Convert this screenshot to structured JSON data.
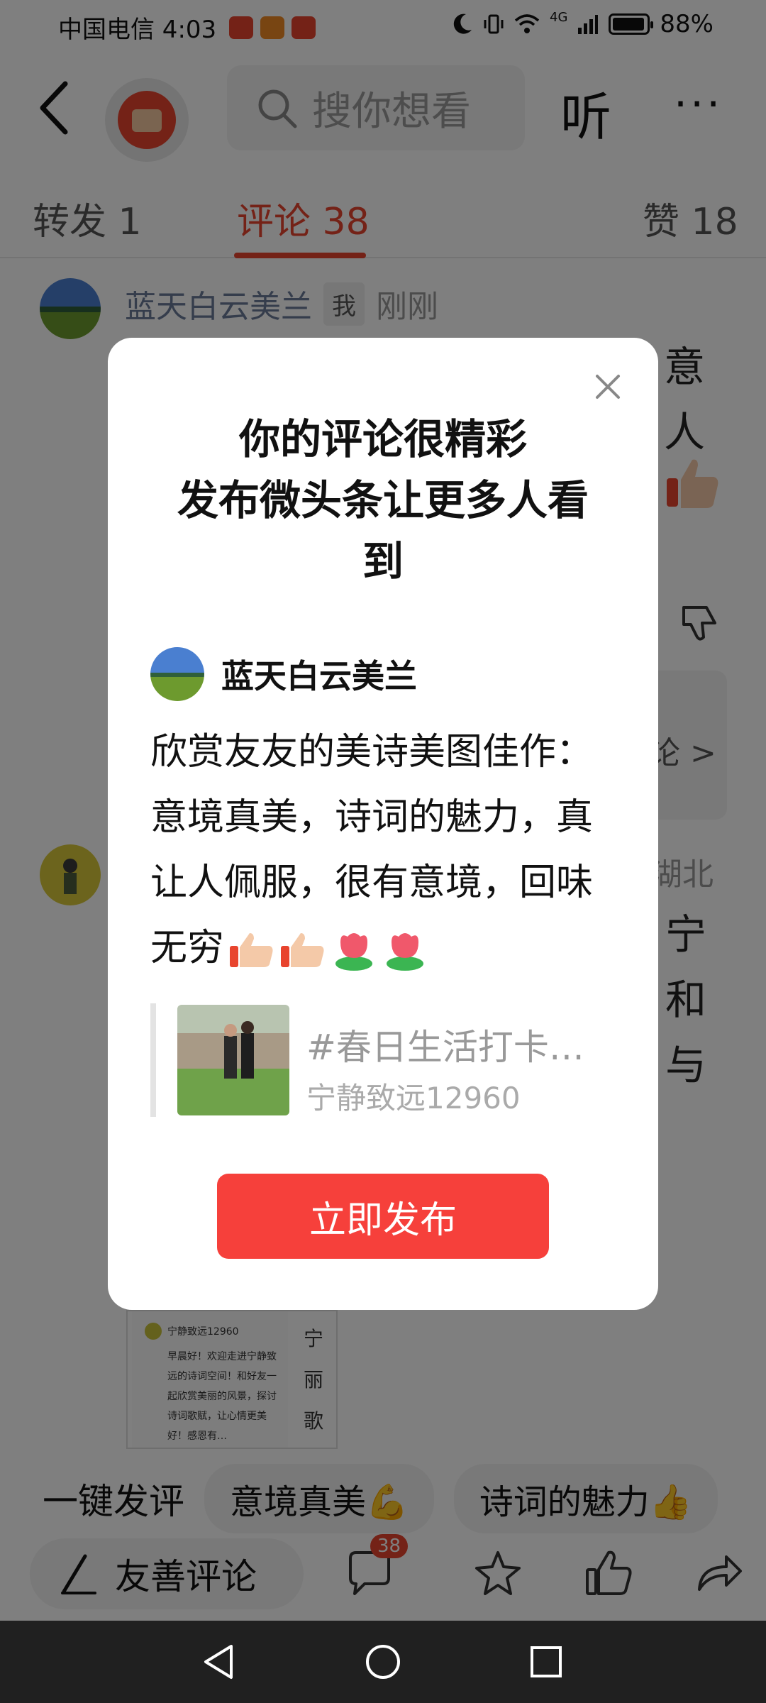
{
  "status_bar": {
    "carrier_time": "中国电信 4:03",
    "network": "4G",
    "battery": "88%"
  },
  "header": {
    "search_placeholder": "搜你想看",
    "listen_label": "听",
    "more_label": "···"
  },
  "tabs": [
    {
      "label": "转发 1"
    },
    {
      "label": "评论 38"
    },
    {
      "label": "赞 18"
    }
  ],
  "background": {
    "comment1": {
      "name": "蓝天白云美兰",
      "me_tag": "我",
      "time": "刚刚",
      "frag1": "意",
      "frag2": "人"
    },
    "comment2": {
      "location": "湖北",
      "frag1": "宁",
      "frag2": "和",
      "frag3": "与"
    },
    "reply_arrow": "论 >",
    "thumb_card": {
      "author": "宁静致远12960",
      "text": "早晨好！欢迎走进宁静致远的诗词空间！和好友一起欣赏美丽的风景，探讨诗词歌赋，让心情更美好！感恩有…",
      "side": "宁\n丽\n歌"
    }
  },
  "quick_replies": {
    "title": "一键发评",
    "chips": [
      "意境真美💪",
      "诗词的魅力👍"
    ]
  },
  "action_bar": {
    "input_label": "友善评论",
    "comment_count": "38"
  },
  "modal": {
    "title_line1": "你的评论很精彩",
    "title_line2": "发布微头条让更多人看",
    "title_line3": "到",
    "author": "蓝天白云美兰",
    "comment": "欣赏友友的美诗美图佳作：意境真美，诗词的魅力，真让人佩服，很有意境，回味无穷",
    "quote_title": "#春日生活打卡…",
    "quote_author": "宁静致远12960",
    "publish_label": "立即发布"
  },
  "colors": {
    "accent": "#e8442e",
    "publish_button": "#f6403b"
  }
}
